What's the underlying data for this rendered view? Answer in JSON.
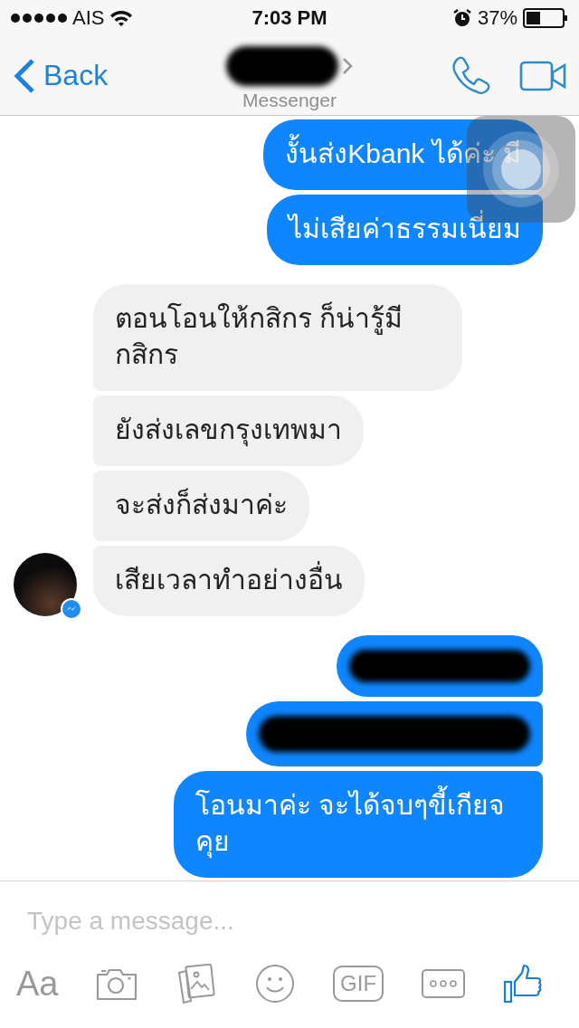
{
  "status_bar": {
    "carrier": "AIS",
    "time": "7:03 PM",
    "battery": "37%"
  },
  "nav": {
    "back": "Back",
    "subtitle": "Messenger"
  },
  "messages": [
    {
      "outgoing": true,
      "kind": "text",
      "text": "งั้นส่งKbank ได้ค่ะ มี",
      "show_avatar": false
    },
    {
      "outgoing": true,
      "kind": "text",
      "text": "ไม่เสียค่าธรรมเนี่ยม",
      "show_avatar": false
    },
    {
      "outgoing": false,
      "kind": "text",
      "text": "ตอนโอนให้กสิกร ก็น่ารู้มีกสิกร",
      "show_avatar": false
    },
    {
      "outgoing": false,
      "kind": "text",
      "text": "ยังส่งเลขกรุงเทพมา",
      "show_avatar": false
    },
    {
      "outgoing": false,
      "kind": "text",
      "text": "จะส่งก็ส่งมาค่ะ",
      "show_avatar": false
    },
    {
      "outgoing": false,
      "kind": "text",
      "text": "เสียเวลาทำอย่างอื่น",
      "show_avatar": true
    },
    {
      "outgoing": true,
      "kind": "redacted",
      "show_avatar": false
    },
    {
      "outgoing": true,
      "kind": "redacted",
      "show_avatar": false
    },
    {
      "outgoing": true,
      "kind": "text",
      "text": "โอนมาค่ะ จะได้จบๆขี้เกียจคุย",
      "show_avatar": false
    }
  ],
  "composer": {
    "placeholder": "Type a message...",
    "text_button": "Aa",
    "gif_button": "GIF"
  }
}
